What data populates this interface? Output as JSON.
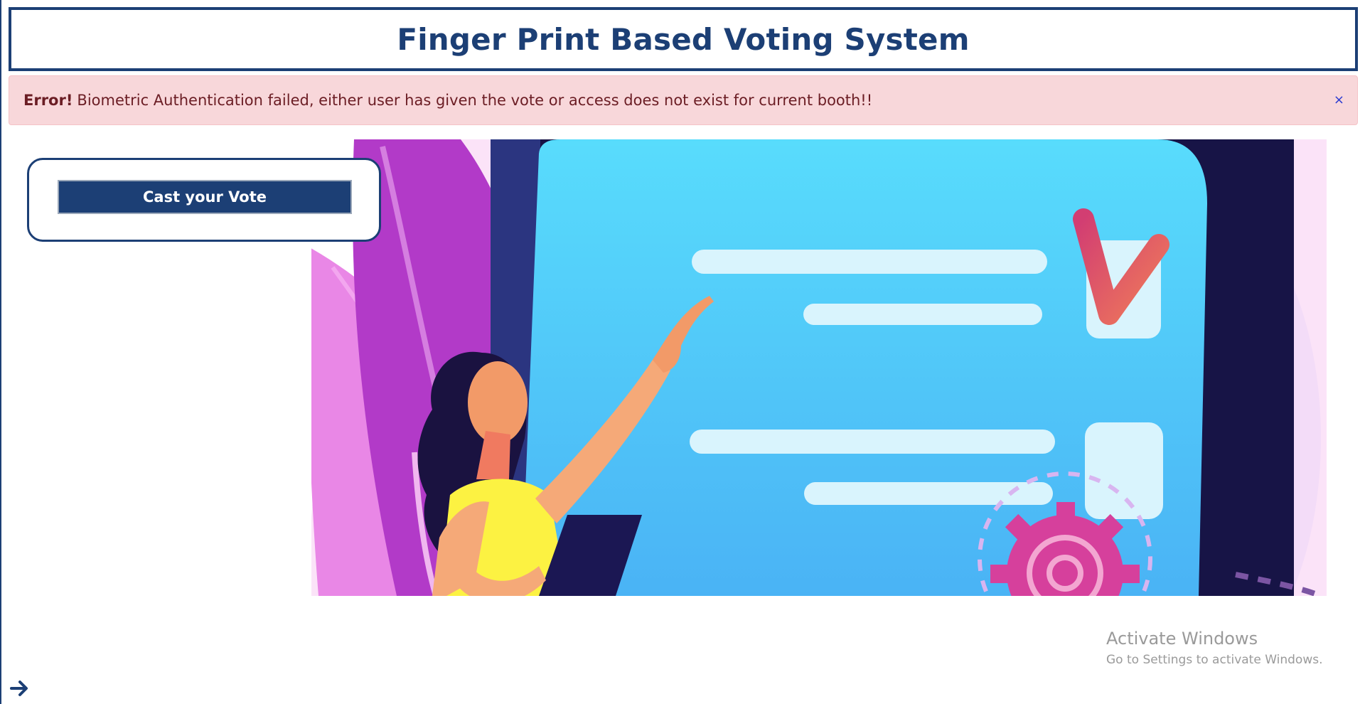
{
  "header": {
    "title": "Finger Print Based Voting System"
  },
  "alert": {
    "strong": "Error!",
    "message": "Biometric Authentication failed, either user has given the vote or access does not exist for current booth!!",
    "close_label": "×"
  },
  "vote_card": {
    "button_label": "Cast your Vote"
  },
  "watermark": {
    "title": "Activate Windows",
    "subtitle": "Go to Settings to activate Windows."
  },
  "icons": {
    "next": "arrow-right-icon",
    "check": "checkmark-icon",
    "gear": "gear-icon"
  },
  "colors": {
    "brand": "#1c3f75",
    "alert_bg": "#f8d7da",
    "alert_text": "#6b1d24"
  }
}
